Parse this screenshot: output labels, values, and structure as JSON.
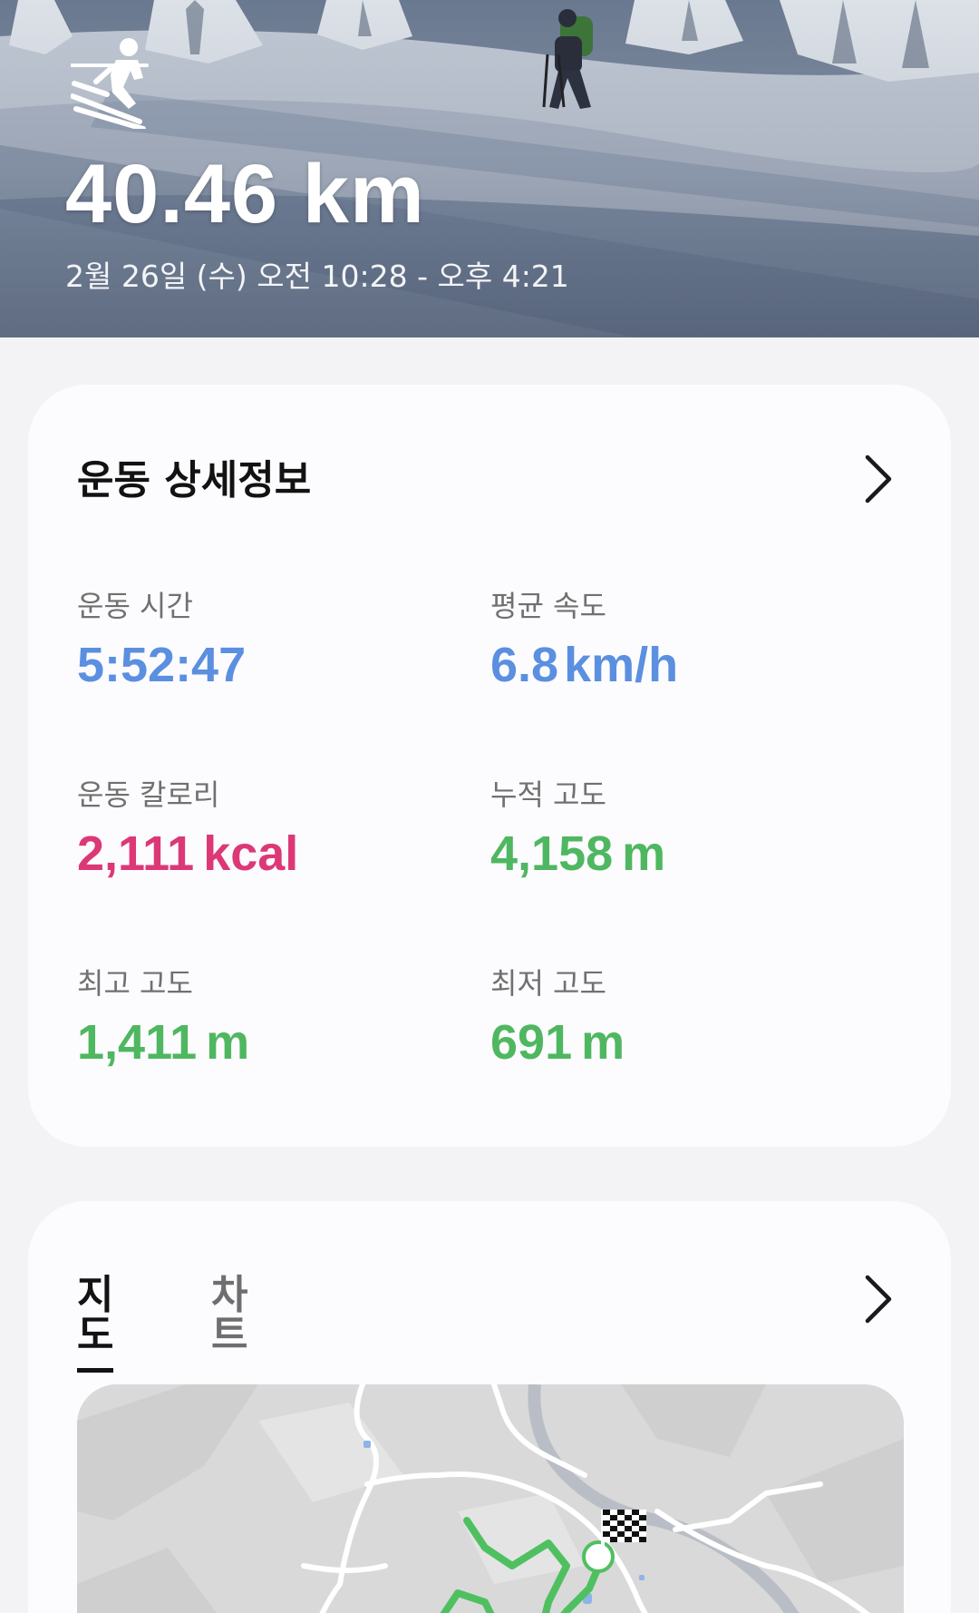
{
  "hero": {
    "activity_icon": "skiing-icon",
    "distance": "40.46 km",
    "datetime": "2월 26일 (수) 오전 10:28 - 오후 4:21"
  },
  "details": {
    "title": "운동 상세정보",
    "chevron_icon": "chevron-right-icon",
    "stats": {
      "duration": {
        "label": "운동 시간",
        "value": "5:52:47",
        "unit": "",
        "color": "#5b8fe0"
      },
      "avg_speed": {
        "label": "평균 속도",
        "value": "6.8",
        "unit": "km/h",
        "color": "#5b8fe0"
      },
      "calories": {
        "label": "운동 칼로리",
        "value": "2,111",
        "unit": "kcal",
        "color": "#dc3878"
      },
      "elevation_gain": {
        "label": "누적 고도",
        "value": "4,158",
        "unit": "m",
        "color": "#4fb760"
      },
      "max_altitude": {
        "label": "최고 고도",
        "value": "1,411",
        "unit": "m",
        "color": "#4fb760"
      },
      "min_altitude": {
        "label": "최저 고도",
        "value": "691",
        "unit": "m",
        "color": "#4fb760"
      }
    }
  },
  "map_section": {
    "tabs": [
      "지도",
      "차트"
    ],
    "active_tab": "지도",
    "chevron_icon": "chevron-right-icon",
    "route_color": "#4fc060",
    "finish_icon": "checkered-flag-icon"
  }
}
